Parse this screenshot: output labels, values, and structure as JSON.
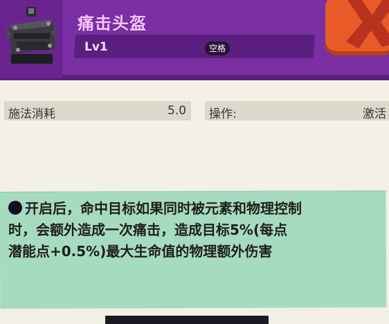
{
  "item": {
    "name": "痛击头盔",
    "level": "Lv1",
    "hotkey": "空格"
  },
  "stats": {
    "cost_label": "施法消耗",
    "cost_value": "5.0",
    "op_label": "操作:",
    "op_value": "激活"
  },
  "description": {
    "line1": "开启后，命中目标如果同时被元素和物理控制",
    "line2": "时，会额外造成一次痛击，造成目标5%(每点",
    "line3": "潜能点+0.5%)最大生命值的物理额外伤害"
  },
  "colors": {
    "header": "#7a2fa2",
    "close_button": "#e85b29",
    "note_bg": "#a7dbbf"
  },
  "icons": {
    "item_icon": "helmet-icon",
    "close": "close-icon"
  }
}
